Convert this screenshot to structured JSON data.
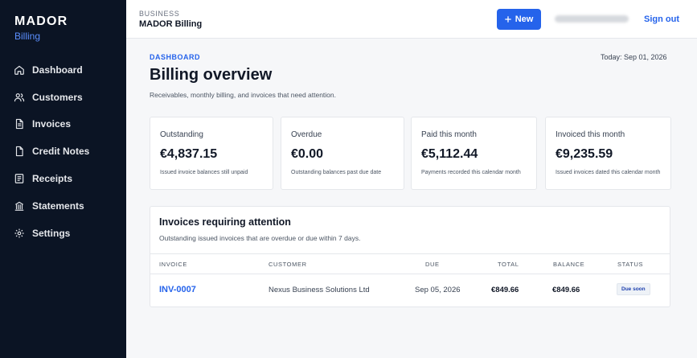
{
  "brand": {
    "name": "MADOR",
    "sub": "Billing"
  },
  "nav": [
    {
      "label": "Dashboard",
      "icon": "home-icon"
    },
    {
      "label": "Customers",
      "icon": "users-icon"
    },
    {
      "label": "Invoices",
      "icon": "invoice-icon"
    },
    {
      "label": "Credit Notes",
      "icon": "credit-note-icon"
    },
    {
      "label": "Receipts",
      "icon": "receipt-icon"
    },
    {
      "label": "Statements",
      "icon": "statement-icon"
    },
    {
      "label": "Settings",
      "icon": "settings-icon"
    }
  ],
  "topbar": {
    "business_label": "BUSINESS",
    "business_name": "MADOR Billing",
    "new_label": "New",
    "signout_label": "Sign out"
  },
  "header": {
    "breadcrumb": "DASHBOARD",
    "today": "Today: Sep 01, 2026",
    "title": "Billing overview",
    "subtitle": "Receivables, monthly billing, and invoices that need attention."
  },
  "cards": [
    {
      "label": "Outstanding",
      "value": "€4,837.15",
      "note": "Issued invoice balances still unpaid"
    },
    {
      "label": "Overdue",
      "value": "€0.00",
      "note": "Outstanding balances past due date"
    },
    {
      "label": "Paid this month",
      "value": "€5,112.44",
      "note": "Payments recorded this calendar month"
    },
    {
      "label": "Invoiced this month",
      "value": "€9,235.59",
      "note": "Issued invoices dated this calendar month"
    }
  ],
  "attention": {
    "title": "Invoices requiring attention",
    "subtitle": "Outstanding issued invoices that are overdue or due within 7 days.",
    "columns": [
      "INVOICE",
      "CUSTOMER",
      "DUE",
      "TOTAL",
      "BALANCE",
      "STATUS"
    ],
    "rows": [
      {
        "invoice": "INV-0007",
        "customer": "Nexus Business Solutions Ltd",
        "due": "Sep 05, 2026",
        "total": "€849.66",
        "balance": "€849.66",
        "status": "Due soon"
      }
    ]
  },
  "colors": {
    "sidebar": "#0b1424",
    "accent": "#2563eb",
    "background": "#f6f7f9"
  }
}
